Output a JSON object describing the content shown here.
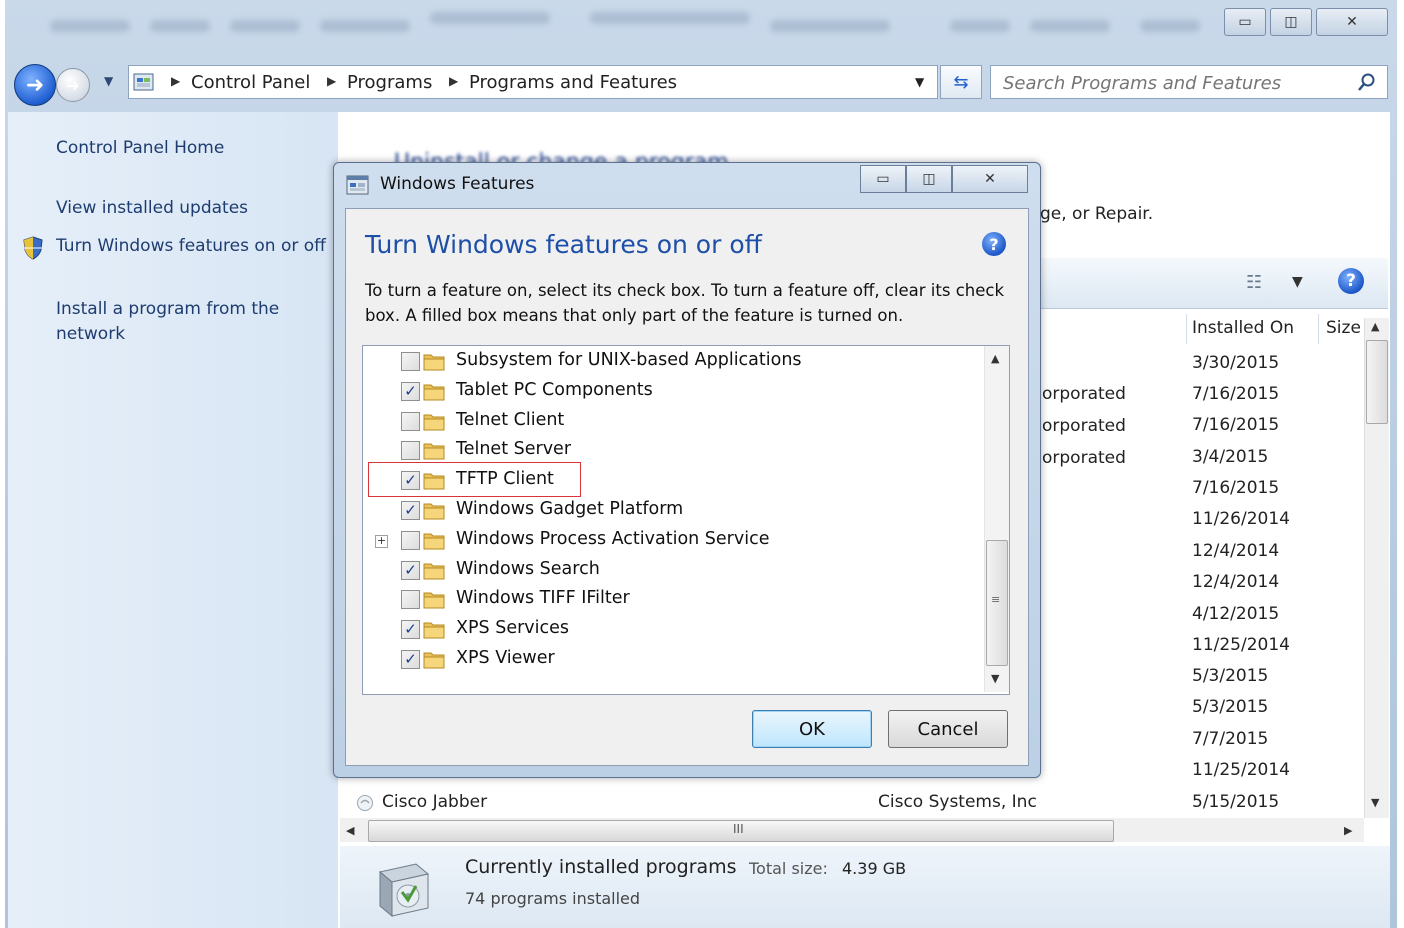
{
  "titlebar": {
    "minimize_icon": "minimize-icon",
    "maximize_icon": "maximize-icon",
    "close_icon": "close-icon"
  },
  "address": {
    "crumbs": [
      "Control Panel",
      "Programs",
      "Programs and Features"
    ],
    "search_placeholder": "Search Programs and Features"
  },
  "sidebar": {
    "items": [
      {
        "label": "Control Panel Home"
      },
      {
        "label": "View installed updates"
      },
      {
        "label": "Turn Windows features on or off"
      },
      {
        "label": "Install a program from the network"
      }
    ]
  },
  "main": {
    "title": "Uninstall or change a program",
    "subtitle_fragment": "ge, or Repair.",
    "columns": {
      "installed_on": "Installed On",
      "size": "Size"
    },
    "publisher_fragments": [
      "orporated",
      "orporated",
      "orporated"
    ],
    "dates": [
      "3/30/2015",
      "7/16/2015",
      "7/16/2015",
      "3/4/2015",
      "7/16/2015",
      "11/26/2014",
      "12/4/2014",
      "12/4/2014",
      "4/12/2015",
      "11/25/2014",
      "5/3/2015",
      "5/3/2015",
      "7/7/2015",
      "11/25/2014",
      "5/15/2015"
    ],
    "last_row": {
      "name": "Cisco Jabber",
      "publisher": "Cisco Systems, Inc",
      "installed_on": "5/15/2015"
    },
    "hscroll_grip": "III"
  },
  "status": {
    "title": "Currently installed programs",
    "total_label": "Total size:",
    "total_value": "4.39 GB",
    "count": "74 programs installed"
  },
  "dialog": {
    "title": "Windows Features",
    "heading": "Turn Windows features on or off",
    "description": "To turn a feature on, select its check box. To turn a feature off, clear its check box. A filled box means that only part of the feature is turned on.",
    "features": [
      {
        "label": "Subsystem for UNIX-based Applications",
        "checked": false,
        "expandable": false
      },
      {
        "label": "Tablet PC Components",
        "checked": true,
        "expandable": false
      },
      {
        "label": "Telnet Client",
        "checked": false,
        "expandable": false
      },
      {
        "label": "Telnet Server",
        "checked": false,
        "expandable": false
      },
      {
        "label": "TFTP Client",
        "checked": true,
        "expandable": false,
        "highlighted": true
      },
      {
        "label": "Windows Gadget Platform",
        "checked": true,
        "expandable": false
      },
      {
        "label": "Windows Process Activation Service",
        "checked": false,
        "expandable": true
      },
      {
        "label": "Windows Search",
        "checked": true,
        "expandable": false
      },
      {
        "label": "Windows TIFF IFilter",
        "checked": false,
        "expandable": false
      },
      {
        "label": "XPS Services",
        "checked": true,
        "expandable": false
      },
      {
        "label": "XPS Viewer",
        "checked": true,
        "expandable": false
      }
    ],
    "ok_label": "OK",
    "cancel_label": "Cancel",
    "help_icon": "help-icon"
  },
  "colors": {
    "accent_blue": "#1e4fa8",
    "highlight_red": "#d9343a",
    "link_blue": "#1e3c70"
  }
}
